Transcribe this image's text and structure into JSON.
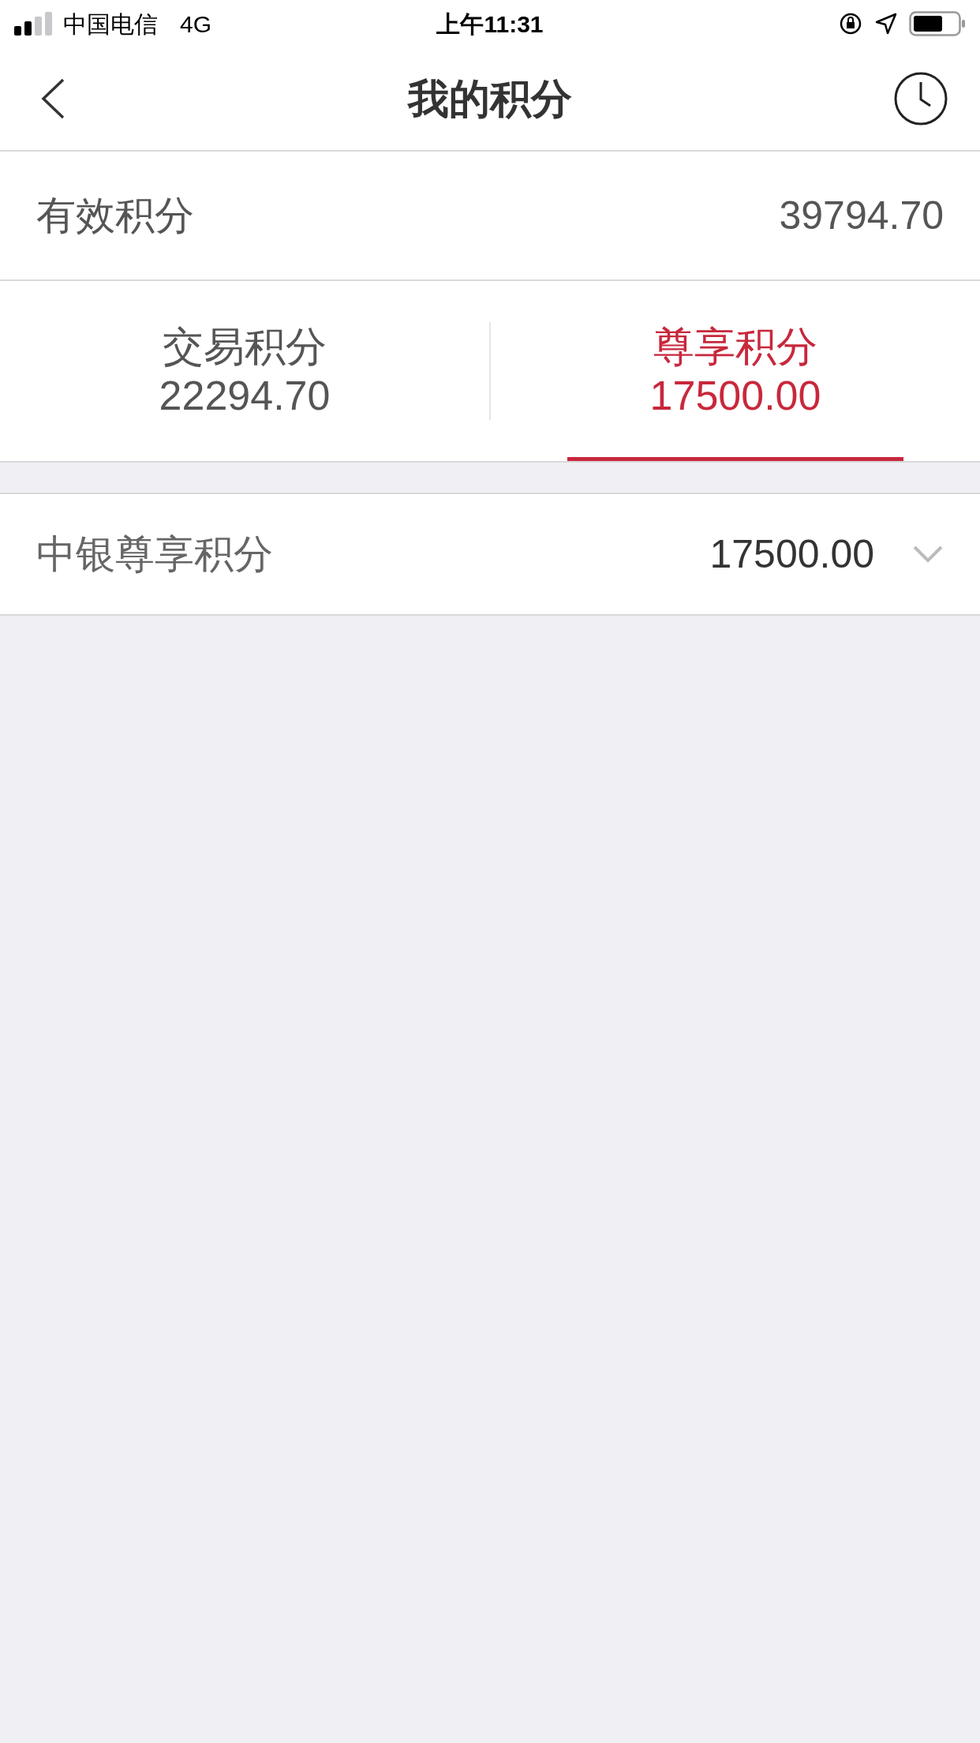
{
  "status_bar": {
    "carrier": "中国电信",
    "network": "4G",
    "time": "上午11:31"
  },
  "nav": {
    "title": "我的积分"
  },
  "total": {
    "label": "有效积分",
    "value": "39794.70"
  },
  "tabs": [
    {
      "label": "交易积分",
      "value": "22294.70",
      "selected": false
    },
    {
      "label": "尊享积分",
      "value": "17500.00",
      "selected": true
    }
  ],
  "detail_row": {
    "label": "中银尊享积分",
    "value": "17500.00",
    "expanded": false
  }
}
